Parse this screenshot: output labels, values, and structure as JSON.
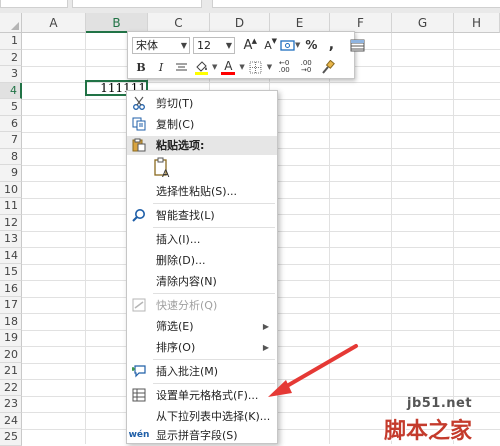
{
  "columns": [
    "A",
    "B",
    "C",
    "D",
    "E",
    "F",
    "G",
    "H"
  ],
  "selected_column": "B",
  "rows": [
    "1",
    "2",
    "3",
    "4",
    "5",
    "6",
    "7",
    "8",
    "9",
    "10",
    "11",
    "12",
    "13",
    "14",
    "15",
    "16",
    "17",
    "18",
    "19",
    "20",
    "21",
    "22",
    "23",
    "24",
    "25"
  ],
  "selected_row": "4",
  "active_cell": {
    "ref": "B4",
    "value": "111111"
  },
  "mini_toolbar": {
    "font_name": "宋体",
    "font_size": "12",
    "increase_font_glyph": "A",
    "decrease_font_glyph": "A",
    "percent_glyph": "%",
    "comma_glyph": ",",
    "bold_glyph": "B",
    "italic_glyph": "I",
    "font_color_glyph": "A",
    "inc_decimal_top": "←0",
    "inc_decimal_bottom": ".00",
    "dec_decimal_top": ".00",
    "dec_decimal_bottom": "→0",
    "fill_color": "#ffff00",
    "font_color": "#ff0000"
  },
  "context_menu": {
    "cut": "剪切(T)",
    "copy": "复制(C)",
    "paste_options": "粘贴选项:",
    "paste_special": "选择性粘贴(S)...",
    "smart_lookup": "智能查找(L)",
    "insert": "插入(I)...",
    "delete": "删除(D)...",
    "clear_contents": "清除内容(N)",
    "quick_analysis": "快速分析(Q)",
    "filter": "筛选(E)",
    "sort": "排序(O)",
    "insert_comment": "插入批注(M)",
    "format_cells": "设置单元格格式(F)...",
    "pick_from_list": "从下拉列表中选择(K)...",
    "phonetic": "显示拼音字段(S)"
  },
  "annotation_arrow_color": "#e53935",
  "watermark": {
    "site": "jb51.net",
    "brand": "脚本之家"
  }
}
